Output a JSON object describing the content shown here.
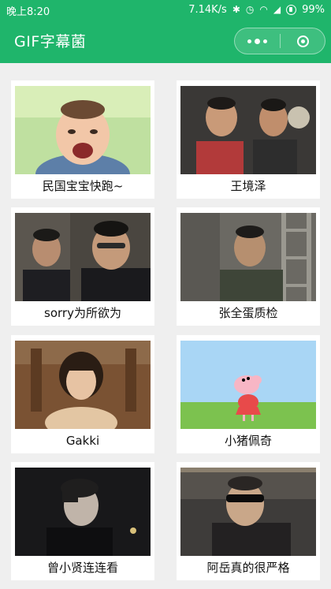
{
  "status_bar": {
    "time": "晚上8:20",
    "network_speed": "7.14K/s",
    "battery": "99%"
  },
  "header": {
    "title": "GIF字幕菌"
  },
  "gifs": [
    {
      "caption": "民国宝宝快跑~"
    },
    {
      "caption": "王境泽"
    },
    {
      "caption": "sorry为所欲为"
    },
    {
      "caption": "张全蛋质检"
    },
    {
      "caption": "Gakki"
    },
    {
      "caption": "小猪佩奇"
    },
    {
      "caption": "曾小贤连连看"
    },
    {
      "caption": "阿岳真的很严格"
    }
  ]
}
